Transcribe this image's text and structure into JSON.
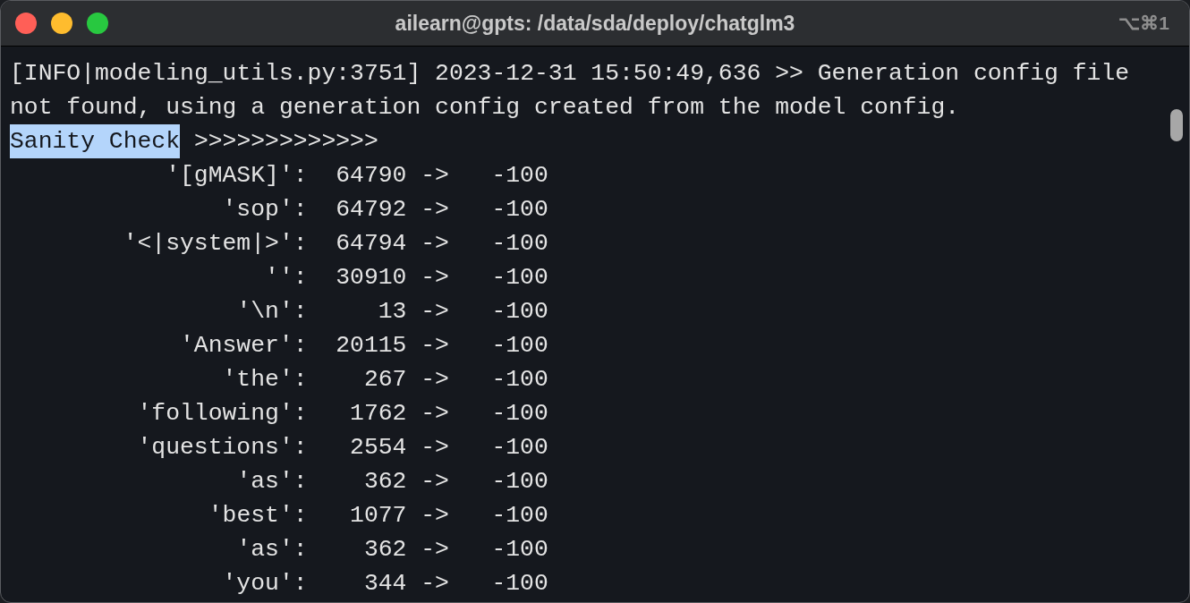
{
  "window": {
    "title": "ailearn@gpts: /data/sda/deploy/chatglm3",
    "shortcut": "⌥⌘1"
  },
  "log_message": "[INFO|modeling_utils.py:3751] 2023-12-31 15:50:49,636 >> Generation config file not found, using a generation config created from the model config.",
  "banner": {
    "segments": [
      {
        "text": "Sanity Check",
        "selected": true
      },
      {
        "text": ">>>>>>>>>>>>>",
        "selected": false
      }
    ]
  },
  "rows": [
    {
      "token": "'[gMASK]':",
      "id": "64790",
      "arrow": "->",
      "label": "-100"
    },
    {
      "token": "'sop':",
      "id": "64792",
      "arrow": "->",
      "label": "-100"
    },
    {
      "token": "'<|system|>':",
      "id": "64794",
      "arrow": "->",
      "label": "-100"
    },
    {
      "token": "'':",
      "id": "30910",
      "arrow": "->",
      "label": "-100"
    },
    {
      "token": "'\\n':",
      "id": "13",
      "arrow": "->",
      "label": "-100"
    },
    {
      "token": "'Answer':",
      "id": "20115",
      "arrow": "->",
      "label": "-100"
    },
    {
      "token": "'the':",
      "id": "267",
      "arrow": "->",
      "label": "-100"
    },
    {
      "token": "'following':",
      "id": "1762",
      "arrow": "->",
      "label": "-100"
    },
    {
      "token": "'questions':",
      "id": "2554",
      "arrow": "->",
      "label": "-100"
    },
    {
      "token": "'as':",
      "id": "362",
      "arrow": "->",
      "label": "-100"
    },
    {
      "token": "'best':",
      "id": "1077",
      "arrow": "->",
      "label": "-100"
    },
    {
      "token": "'as':",
      "id": "362",
      "arrow": "->",
      "label": "-100"
    },
    {
      "token": "'you':",
      "id": "344",
      "arrow": "->",
      "label": "-100"
    }
  ]
}
